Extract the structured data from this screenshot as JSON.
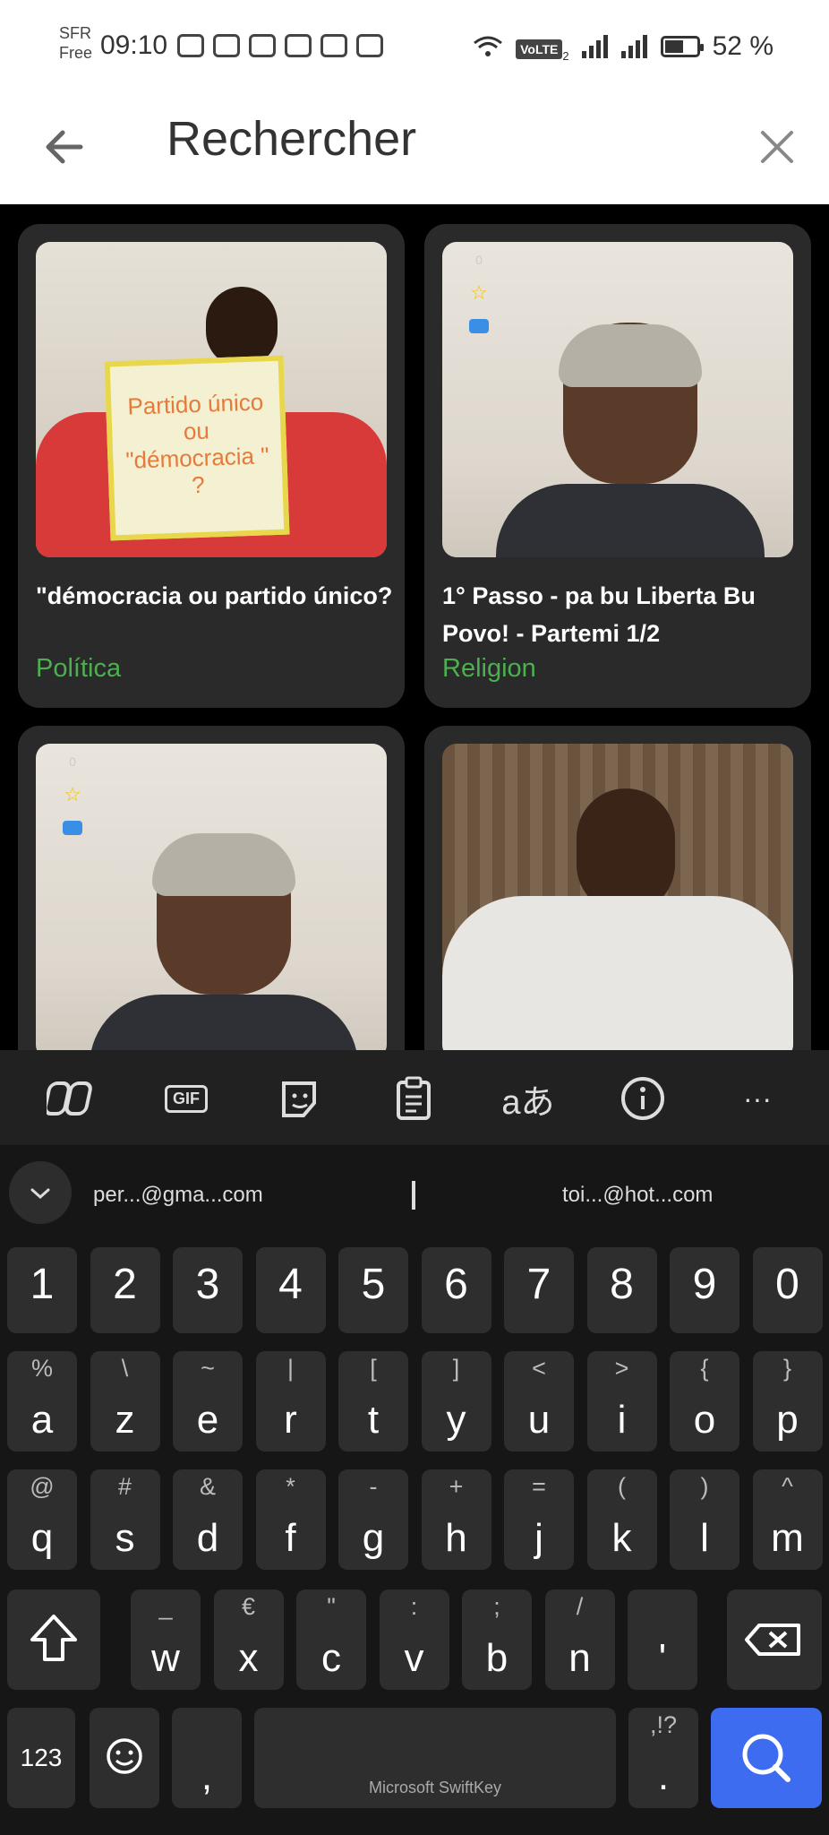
{
  "status_bar": {
    "carrier_line1": "SFR",
    "carrier_line2": "Free",
    "time": "09:10",
    "network_label": "VoLTE",
    "sim_index": "2",
    "battery": "52 %"
  },
  "search_header": {
    "title": "Rechercher"
  },
  "results": [
    {
      "title": "\"démocracia ou partido único?",
      "category": "Política",
      "sign_text": "Partido único ou \"démocracia \" ?"
    },
    {
      "title": "1° Passo - pa bu Liberta Bu Povo! - Partemi 1/2",
      "category": "Religion",
      "counter": "0"
    },
    {
      "title": "",
      "category": "",
      "counter": "0"
    },
    {
      "title": "",
      "category": ""
    }
  ],
  "category_color": "#4caf50",
  "keyboard": {
    "suggestions": [
      "per...@gma...com",
      "toi...@hot...com"
    ],
    "number_row": [
      "1",
      "2",
      "3",
      "4",
      "5",
      "6",
      "7",
      "8",
      "9",
      "0"
    ],
    "row1": [
      {
        "main": "a",
        "sub": "%"
      },
      {
        "main": "z",
        "sub": "\\"
      },
      {
        "main": "e",
        "sub": "~"
      },
      {
        "main": "r",
        "sub": "|"
      },
      {
        "main": "t",
        "sub": "["
      },
      {
        "main": "y",
        "sub": "]"
      },
      {
        "main": "u",
        "sub": "<"
      },
      {
        "main": "i",
        "sub": ">"
      },
      {
        "main": "o",
        "sub": "{"
      },
      {
        "main": "p",
        "sub": "}"
      }
    ],
    "row2": [
      {
        "main": "q",
        "sub": "@"
      },
      {
        "main": "s",
        "sub": "#"
      },
      {
        "main": "d",
        "sub": "&"
      },
      {
        "main": "f",
        "sub": "*"
      },
      {
        "main": "g",
        "sub": "-"
      },
      {
        "main": "h",
        "sub": "+"
      },
      {
        "main": "j",
        "sub": "="
      },
      {
        "main": "k",
        "sub": "("
      },
      {
        "main": "l",
        "sub": ")"
      },
      {
        "main": "m",
        "sub": "^"
      }
    ],
    "row3": [
      {
        "main": "w",
        "sub": "_"
      },
      {
        "main": "x",
        "sub": "€"
      },
      {
        "main": "c",
        "sub": "\""
      },
      {
        "main": "v",
        "sub": ":"
      },
      {
        "main": "b",
        "sub": ";"
      },
      {
        "main": "n",
        "sub": "/"
      },
      {
        "main": "'",
        "sub": ""
      }
    ],
    "numbers_label": "123",
    "comma": ",",
    "period_sub": ",!?",
    "period": ".",
    "space_label": "Microsoft SwiftKey",
    "accent": "#3e6cf0"
  }
}
